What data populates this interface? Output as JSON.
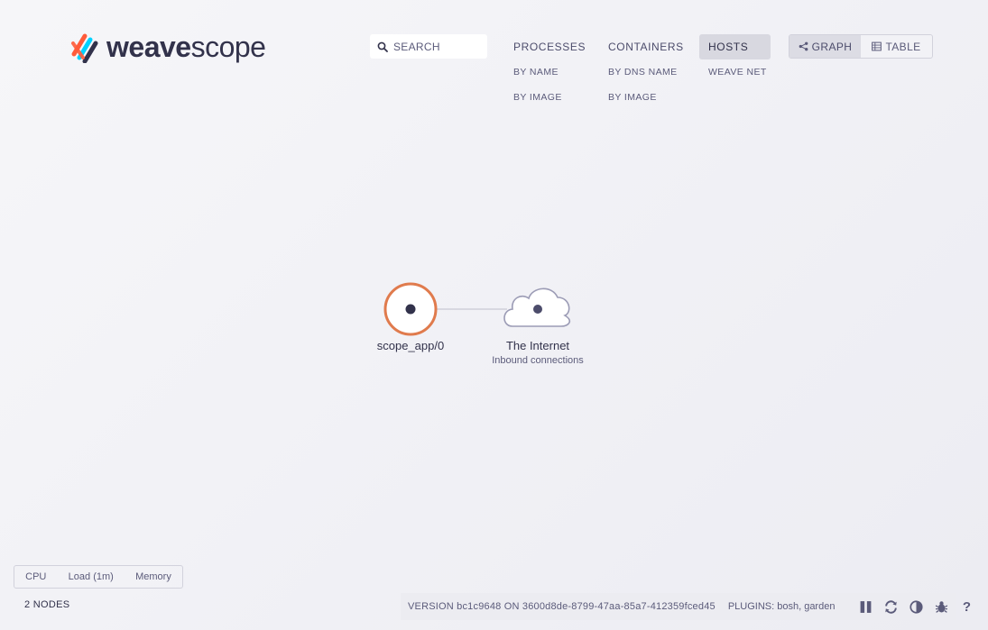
{
  "app": {
    "logo_text_bold": "weave",
    "logo_text_light": "scope"
  },
  "search": {
    "placeholder": "SEARCH",
    "icon": "search-icon"
  },
  "topologies": [
    {
      "label": "PROCESSES",
      "active": false,
      "subs": [
        "BY NAME",
        "BY IMAGE"
      ]
    },
    {
      "label": "CONTAINERS",
      "active": false,
      "subs": [
        "BY DNS NAME",
        "BY IMAGE"
      ]
    },
    {
      "label": "HOSTS",
      "active": true,
      "subs": [
        "WEAVE NET"
      ]
    }
  ],
  "view_modes": {
    "graph_label": "GRAPH",
    "table_label": "TABLE",
    "active": "graph"
  },
  "graph": {
    "nodes": [
      {
        "label": "scope_app/0",
        "sublabel": "",
        "shape": "circle"
      },
      {
        "label": "The Internet",
        "sublabel": "Inbound connections",
        "shape": "cloud"
      }
    ]
  },
  "metrics": {
    "items": [
      "CPU",
      "Load (1m)",
      "Memory"
    ]
  },
  "status": {
    "node_count": "2 NODES"
  },
  "footer": {
    "version": "VERSION bc1c9648 ON 3600d8de-8799-47aa-85a7-412359fced45",
    "plugins": "PLUGINS: bosh, garden",
    "help": "?"
  },
  "colors": {
    "accent_orange": "#e07b4d",
    "node_dark": "#32324b",
    "cloud_stroke": "#9b9bb5"
  }
}
